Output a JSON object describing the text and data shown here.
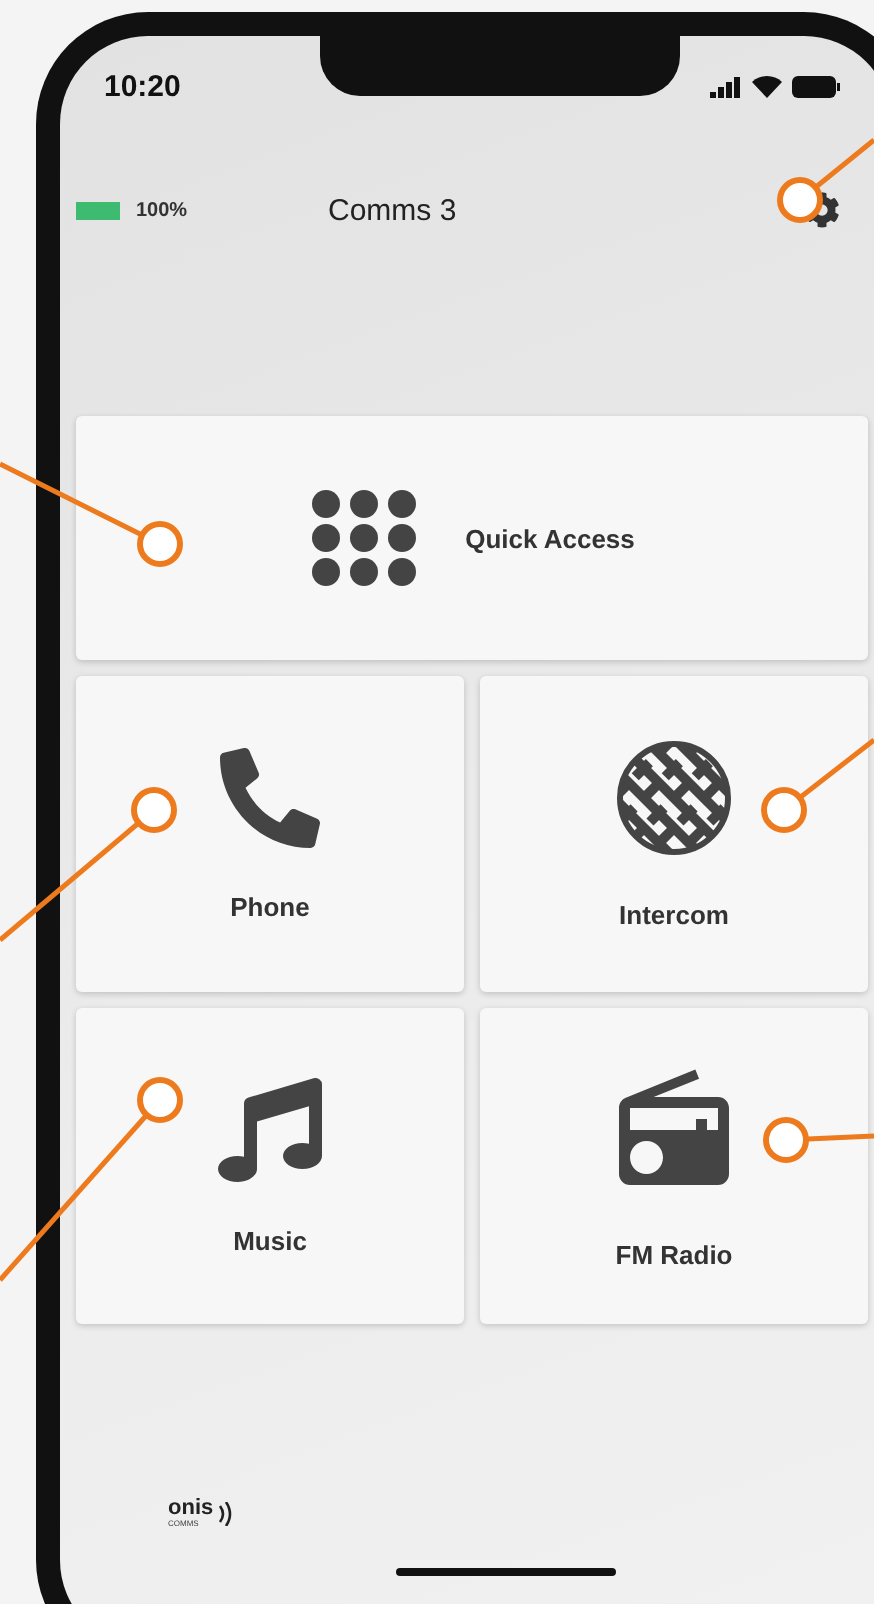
{
  "status_bar": {
    "time": "10:20"
  },
  "header": {
    "battery": {
      "level": 1.0,
      "reading": "100%"
    },
    "title": "Comms 3"
  },
  "tiles": [
    {
      "label": "Quick Access",
      "kind": "grid"
    },
    {
      "label": "Phone",
      "kind": "phone"
    },
    {
      "label": "Intercom",
      "kind": "intercom"
    },
    {
      "label": "Music",
      "kind": "music"
    },
    {
      "label": "FM Radio",
      "kind": "radio"
    }
  ],
  "logo": {
    "text": "onis",
    "subtext": "COMMS"
  }
}
